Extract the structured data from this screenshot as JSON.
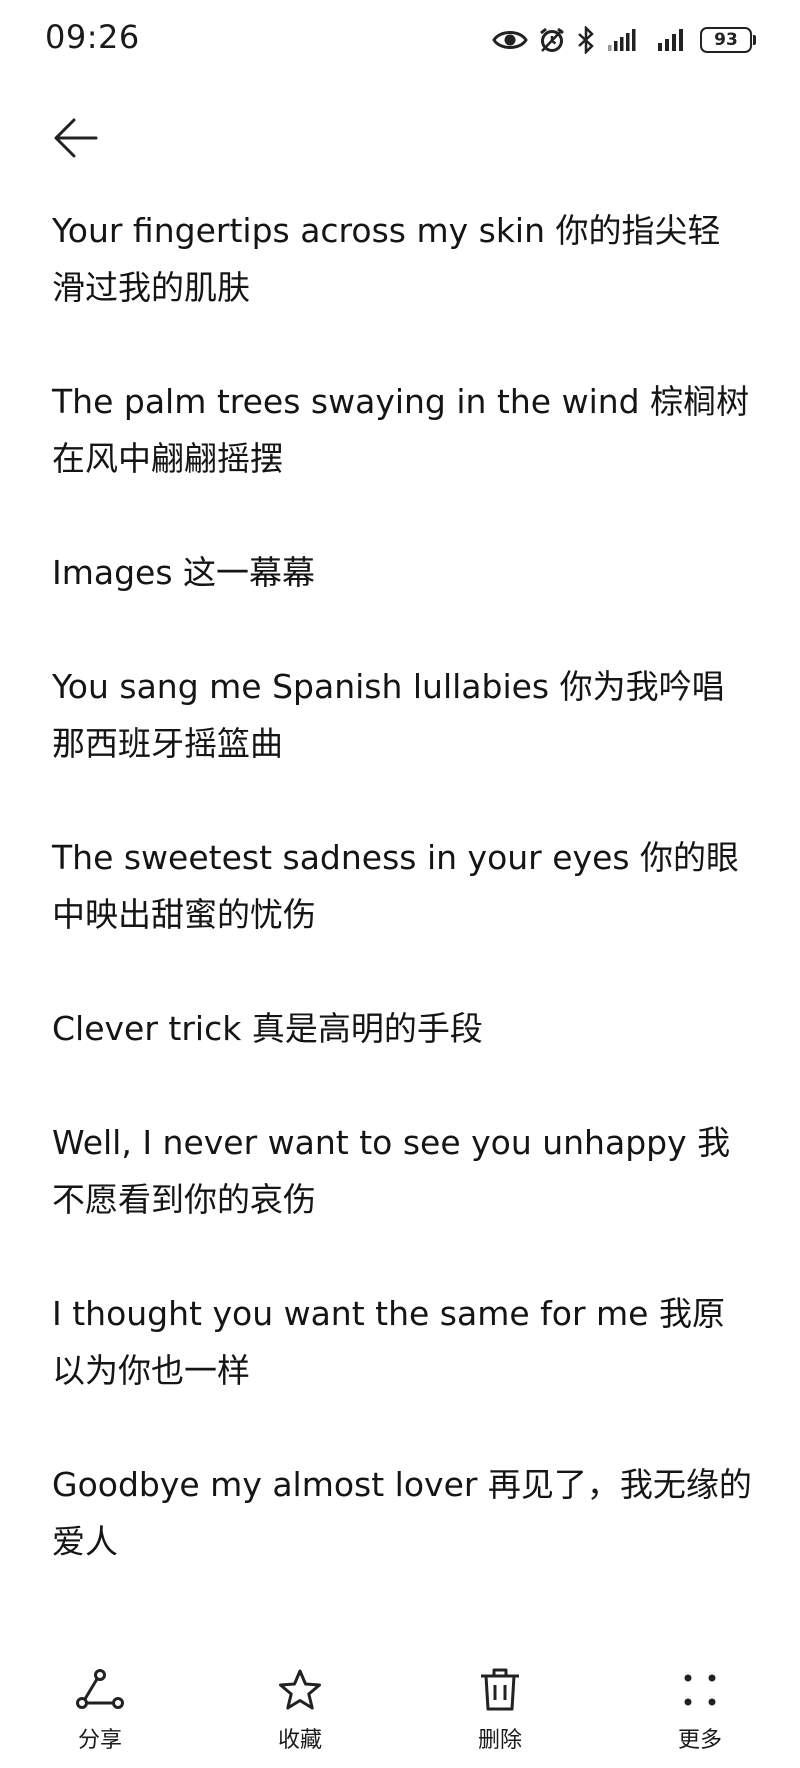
{
  "status_bar": {
    "time": "09:26",
    "battery": "93",
    "icons": [
      "eye-icon",
      "alarm-icon",
      "bluetooth-icon",
      "signal-icon",
      "signal-icon",
      "battery-icon"
    ]
  },
  "nav": {
    "back_icon": "arrow-left-icon"
  },
  "lyrics": [
    "Your fingertips across my skin 你的指尖轻滑过我的肌肤",
    "The palm trees swaying in the wind 棕榈树在风中翩翩摇摆",
    "Images 这一幕幕",
    "You sang me Spanish lullabies 你为我吟唱那西班牙摇篮曲",
    "The sweetest sadness in your eyes 你的眼中映出甜蜜的忧伤",
    "Clever trick 真是高明的手段",
    "Well, I never want to see you unhappy 我不愿看到你的哀伤",
    "I thought you want the same for me 我原以为你也一样",
    "Goodbye my almost lover 再见了，我无缘的爱人"
  ],
  "toolbar": {
    "share_label": "分享",
    "favorite_label": "收藏",
    "delete_label": "删除",
    "more_label": "更多"
  }
}
